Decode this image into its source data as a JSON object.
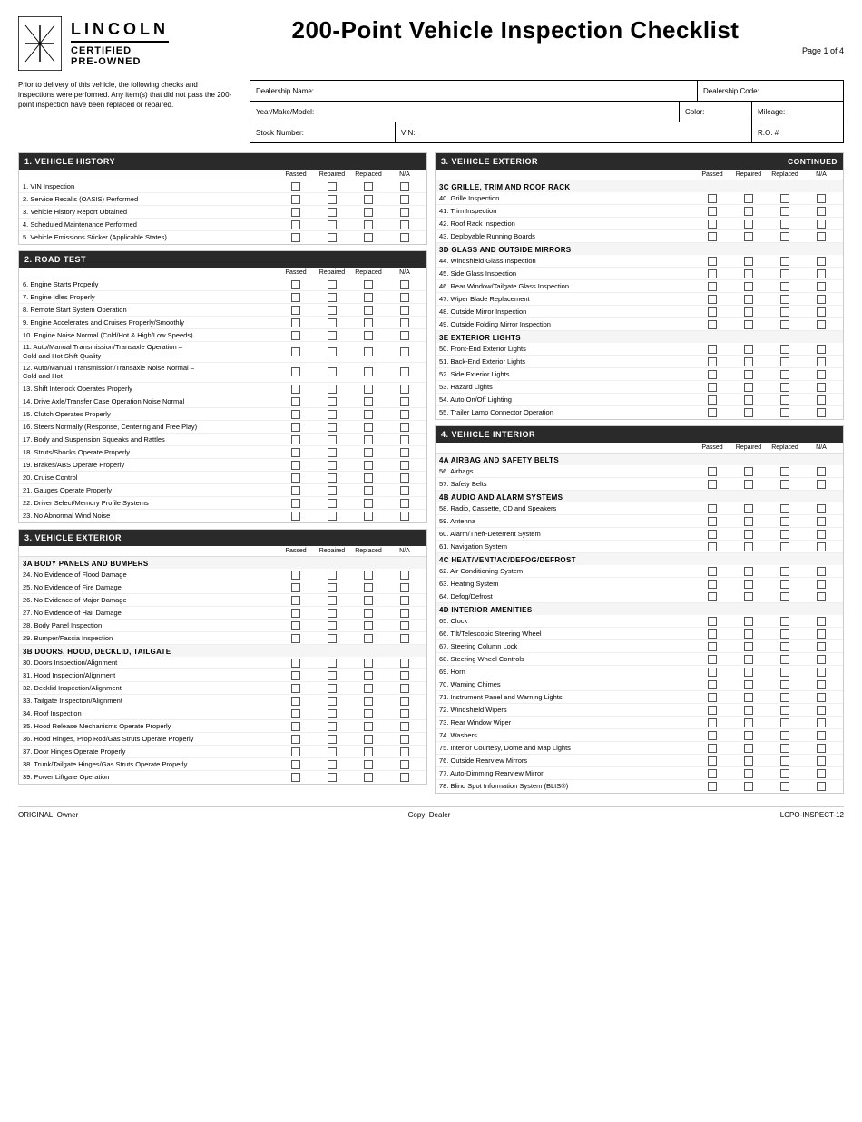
{
  "header": {
    "brand_lincoln": "LINCOLN",
    "brand_certified": "CERTIFIED",
    "brand_preowned": "PRE-OWNED",
    "main_title": "200-Point Vehicle Inspection Checklist",
    "page_num": "Page 1 of 4"
  },
  "intro": {
    "text": "Prior to delivery of this vehicle, the following checks and inspections were performed. Any item(s) that did not pass the 200-point inspection have been replaced or repaired."
  },
  "form_fields": {
    "dealership_name_label": "Dealership Name:",
    "dealership_code_label": "Dealership Code:",
    "year_make_model_label": "Year/Make/Model:",
    "color_label": "Color:",
    "mileage_label": "Mileage:",
    "stock_number_label": "Stock Number:",
    "vin_label": "VIN:",
    "ro_label": "R.O. #"
  },
  "col_headers": [
    "Passed",
    "Repaired",
    "Replaced",
    "N/A"
  ],
  "sections": {
    "left": [
      {
        "id": "vehicle-history",
        "title": "1. VEHICLE HISTORY",
        "items": [
          {
            "num": "1.",
            "label": "VIN Inspection"
          },
          {
            "num": "2.",
            "label": "Service Recalls (OASIS) Performed"
          },
          {
            "num": "3.",
            "label": "Vehicle History Report Obtained"
          },
          {
            "num": "4.",
            "label": "Scheduled Maintenance Performed"
          },
          {
            "num": "5.",
            "label": "Vehicle Emissions Sticker (Applicable States)"
          }
        ]
      },
      {
        "id": "road-test",
        "title": "2. ROAD TEST",
        "items": [
          {
            "num": "6.",
            "label": "Engine Starts Properly"
          },
          {
            "num": "7.",
            "label": "Engine Idles Properly"
          },
          {
            "num": "8.",
            "label": "Remote Start System Operation"
          },
          {
            "num": "9.",
            "label": "Engine Accelerates and Cruises Properly/Smoothly"
          },
          {
            "num": "10.",
            "label": "Engine Noise Normal (Cold/Hot & High/Low Speeds)"
          },
          {
            "num": "11.",
            "label": "Auto/Manual Transmission/Transaxle Operation – Cold and Hot Shift Quality",
            "multiline": true
          },
          {
            "num": "12.",
            "label": "Auto/Manual Transmission/Transaxle Noise Normal – Cold and Hot",
            "multiline": true
          },
          {
            "num": "13.",
            "label": "Shift Interlock Operates Properly"
          },
          {
            "num": "14.",
            "label": "Drive Axle/Transfer Case Operation Noise Normal"
          },
          {
            "num": "15.",
            "label": "Clutch Operates Properly"
          },
          {
            "num": "16.",
            "label": "Steers Normally (Response, Centering and Free Play)"
          },
          {
            "num": "17.",
            "label": "Body and Suspension Squeaks and Rattles"
          },
          {
            "num": "18.",
            "label": "Struts/Shocks Operate Properly"
          },
          {
            "num": "19.",
            "label": "Brakes/ABS Operate Properly"
          },
          {
            "num": "20.",
            "label": "Cruise Control"
          },
          {
            "num": "21.",
            "label": "Gauges Operate Properly"
          },
          {
            "num": "22.",
            "label": "Driver Select/Memory Profile Systems"
          },
          {
            "num": "23.",
            "label": "No Abnormal Wind Noise"
          }
        ]
      },
      {
        "id": "vehicle-exterior-left",
        "title": "3. VEHICLE EXTERIOR",
        "subsections": [
          {
            "sub_title": "3A BODY PANELS AND BUMPERS",
            "items": [
              {
                "num": "24.",
                "label": "No Evidence of Flood Damage"
              },
              {
                "num": "25.",
                "label": "No Evidence of Fire Damage"
              },
              {
                "num": "26.",
                "label": "No Evidence of Major Damage"
              },
              {
                "num": "27.",
                "label": "No Evidence of Hail Damage"
              },
              {
                "num": "28.",
                "label": "Body Panel Inspection"
              },
              {
                "num": "29.",
                "label": "Bumper/Fascia Inspection"
              }
            ]
          },
          {
            "sub_title": "3B DOORS, HOOD, DECKLID, TAILGATE",
            "items": [
              {
                "num": "30.",
                "label": "Doors Inspection/Alignment"
              },
              {
                "num": "31.",
                "label": "Hood Inspection/Alignment"
              },
              {
                "num": "32.",
                "label": "Decklid Inspection/Alignment"
              },
              {
                "num": "33.",
                "label": "Tailgate Inspection/Alignment"
              },
              {
                "num": "34.",
                "label": "Roof Inspection"
              },
              {
                "num": "35.",
                "label": "Hood Release Mechanisms Operate Properly"
              },
              {
                "num": "36.",
                "label": "Hood Hinges, Prop Rod/Gas Struts Operate Properly"
              },
              {
                "num": "37.",
                "label": "Door Hinges Operate Properly"
              },
              {
                "num": "38.",
                "label": "Trunk/Tailgate Hinges/Gas Struts Operate Properly"
              },
              {
                "num": "39.",
                "label": "Power Liftgate Operation"
              }
            ]
          }
        ]
      }
    ],
    "right": [
      {
        "id": "vehicle-exterior-right",
        "title": "3. VEHICLE EXTERIOR",
        "continued": "CONTINUED",
        "subsections": [
          {
            "sub_title": "3C GRILLE, TRIM AND ROOF RACK",
            "items": [
              {
                "num": "40.",
                "label": "Grille Inspection"
              },
              {
                "num": "41.",
                "label": "Trim Inspection"
              },
              {
                "num": "42.",
                "label": "Roof Rack Inspection"
              },
              {
                "num": "43.",
                "label": "Deployable Running Boards"
              }
            ]
          },
          {
            "sub_title": "3D GLASS AND OUTSIDE MIRRORS",
            "items": [
              {
                "num": "44.",
                "label": "Windshield Glass Inspection"
              },
              {
                "num": "45.",
                "label": "Side Glass Inspection"
              },
              {
                "num": "46.",
                "label": "Rear Window/Tailgate Glass Inspection"
              },
              {
                "num": "47.",
                "label": "Wiper Blade Replacement"
              },
              {
                "num": "48.",
                "label": "Outside Mirror Inspection"
              },
              {
                "num": "49.",
                "label": "Outside Folding Mirror Inspection"
              }
            ]
          },
          {
            "sub_title": "3E EXTERIOR LIGHTS",
            "items": [
              {
                "num": "50.",
                "label": "Front-End Exterior Lights"
              },
              {
                "num": "51.",
                "label": "Back-End Exterior Lights"
              },
              {
                "num": "52.",
                "label": "Side Exterior Lights"
              },
              {
                "num": "53.",
                "label": "Hazard Lights"
              },
              {
                "num": "54.",
                "label": "Auto On/Off Lighting"
              },
              {
                "num": "55.",
                "label": "Trailer Lamp Connector Operation"
              }
            ]
          }
        ]
      },
      {
        "id": "vehicle-interior",
        "title": "4. VEHICLE INTERIOR",
        "subsections": [
          {
            "sub_title": "4A AIRBAG AND SAFETY BELTS",
            "items": [
              {
                "num": "56.",
                "label": "Airbags"
              },
              {
                "num": "57.",
                "label": "Safety Belts"
              }
            ]
          },
          {
            "sub_title": "4B AUDIO AND ALARM SYSTEMS",
            "items": [
              {
                "num": "58.",
                "label": "Radio, Cassette, CD and Speakers"
              },
              {
                "num": "59.",
                "label": "Antenna"
              },
              {
                "num": "60.",
                "label": "Alarm/Theft-Deterrent System"
              },
              {
                "num": "61.",
                "label": "Navigation System"
              }
            ]
          },
          {
            "sub_title": "4C HEAT/VENT/AC/DEFOG/DEFROST",
            "items": [
              {
                "num": "62.",
                "label": "Air Conditioning System"
              },
              {
                "num": "63.",
                "label": "Heating System"
              },
              {
                "num": "64.",
                "label": "Defog/Defrost"
              }
            ]
          },
          {
            "sub_title": "4D INTERIOR AMENITIES",
            "items": [
              {
                "num": "65.",
                "label": "Clock"
              },
              {
                "num": "66.",
                "label": "Tilt/Telescopic Steering Wheel"
              },
              {
                "num": "67.",
                "label": "Steering Column Lock"
              },
              {
                "num": "68.",
                "label": "Steering Wheel Controls"
              },
              {
                "num": "69.",
                "label": "Horn"
              },
              {
                "num": "70.",
                "label": "Warning Chimes"
              },
              {
                "num": "71.",
                "label": "Instrument Panel and Warning Lights"
              },
              {
                "num": "72.",
                "label": "Windshield Wipers"
              },
              {
                "num": "73.",
                "label": "Rear Window Wiper"
              },
              {
                "num": "74.",
                "label": "Washers"
              },
              {
                "num": "75.",
                "label": "Interior Courtesy, Dome and Map Lights"
              },
              {
                "num": "76.",
                "label": "Outside Rearview Mirrors"
              },
              {
                "num": "77.",
                "label": "Auto-Dimming Rearview Mirror"
              },
              {
                "num": "78.",
                "label": "Blind Spot Information System (BLIS®)"
              }
            ]
          }
        ]
      }
    ]
  },
  "footer": {
    "original": "ORIGINAL: Owner",
    "copy": "Copy: Dealer",
    "code": "LCPO-INSPECT-12"
  }
}
